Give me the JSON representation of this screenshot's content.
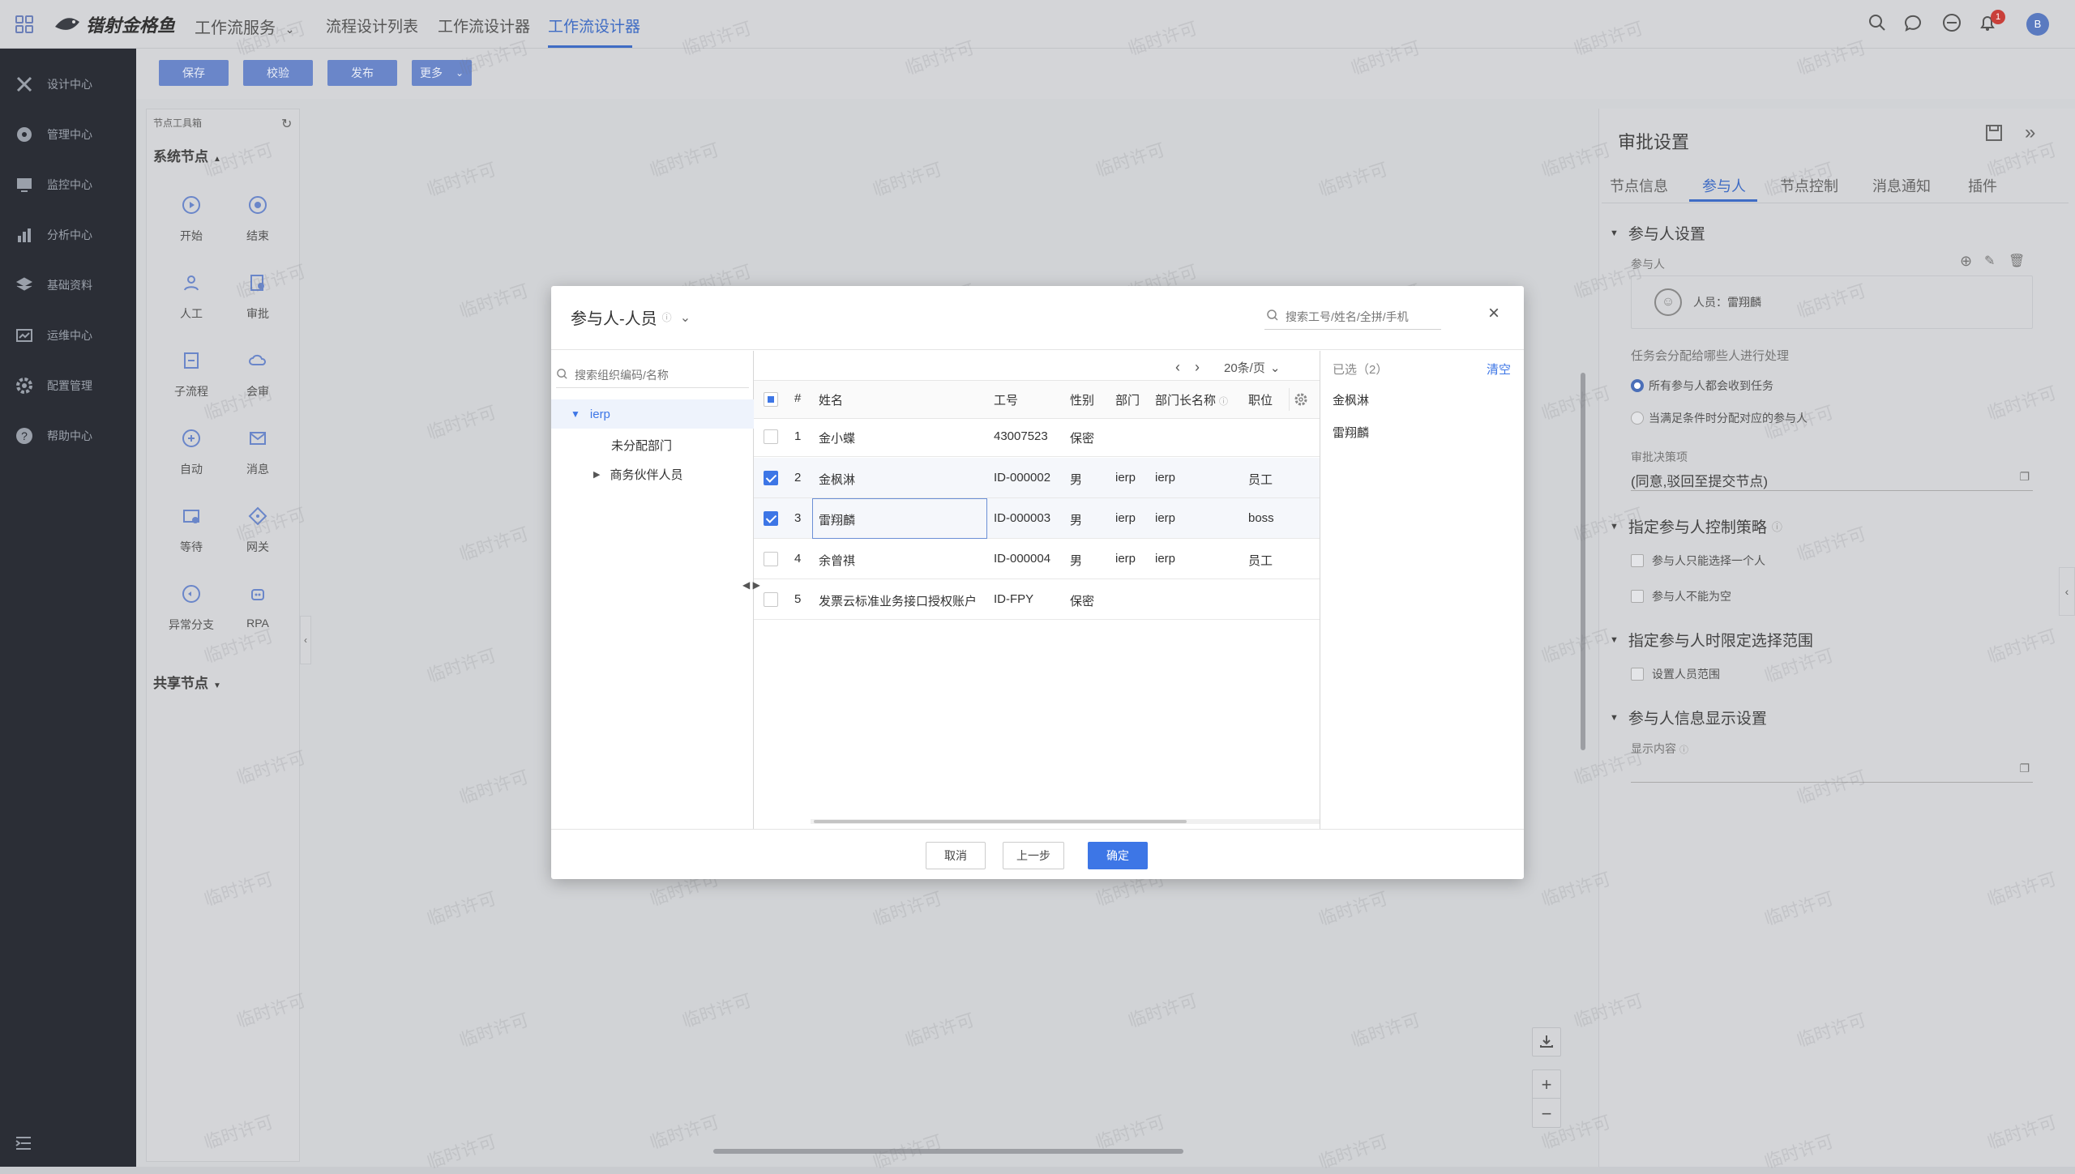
{
  "topbar": {
    "brand": "锴射金格鱼",
    "menu_service": "工作流服务",
    "nav": [
      "流程设计列表",
      "工作流设计器",
      "工作流设计器"
    ],
    "active_index": 2,
    "notice_count": "1",
    "avatar": "B"
  },
  "sidebar": {
    "items": [
      "设计中心",
      "管理中心",
      "监控中心",
      "分析中心",
      "基础资料",
      "运维中心",
      "配置管理",
      "帮助中心"
    ]
  },
  "toolbar": {
    "save": "保存",
    "check": "校验",
    "publish": "发布",
    "more": "更多"
  },
  "toolbox": {
    "title": "节点工具箱",
    "system_nodes": "系统节点",
    "shared_nodes": "共享节点",
    "nodes": [
      "开始",
      "结束",
      "人工",
      "审批",
      "子流程",
      "会审",
      "自动",
      "消息",
      "等待",
      "网关",
      "异常分支",
      "RPA"
    ]
  },
  "panel": {
    "title": "审批设置",
    "tabs": [
      "节点信息",
      "参与人",
      "节点控制",
      "消息通知",
      "插件"
    ],
    "active_tab": 1,
    "sec1": "参与人设置",
    "participant_label": "参与人",
    "participant_value": "人员：雷翔麟",
    "dispatch_label": "任务会分配给哪些人进行处理",
    "radio1": "所有参与人都会收到任务",
    "radio2": "当满足条件时分配对应的参与人",
    "decision_label": "审批决策项",
    "decision_value": "(同意,驳回至提交节点)",
    "sec2": "指定参与人控制策略",
    "opt1": "参与人只能选择一个人",
    "opt2": "参与人不能为空",
    "sec3": "指定参与人时限定选择范围",
    "opt3": "设置人员范围",
    "sec4": "参与人信息显示设置",
    "display_label": "显示内容"
  },
  "modal": {
    "title": "参与人-人员",
    "search_placeholder": "搜索工号/姓名/全拼/手机",
    "tree_placeholder": "搜索组织编码/名称",
    "tree": [
      "ierp",
      "未分配部门",
      "商务伙伴人员"
    ],
    "page_size": "20条/页",
    "columns": [
      "#",
      "姓名",
      "工号",
      "性别",
      "部门",
      "部门长名称",
      "职位"
    ],
    "rows": [
      {
        "no": "1",
        "name": "金小蝶",
        "id": "43007523",
        "sex": "保密",
        "dept": "",
        "head": "",
        "pos": "",
        "checked": false
      },
      {
        "no": "2",
        "name": "金枫淋",
        "id": "ID-000002",
        "sex": "男",
        "dept": "ierp",
        "head": "ierp",
        "pos": "员工",
        "checked": true
      },
      {
        "no": "3",
        "name": "雷翔麟",
        "id": "ID-000003",
        "sex": "男",
        "dept": "ierp",
        "head": "ierp",
        "pos": "boss",
        "checked": true
      },
      {
        "no": "4",
        "name": "余曾祺",
        "id": "ID-000004",
        "sex": "男",
        "dept": "ierp",
        "head": "ierp",
        "pos": "员工",
        "checked": false
      },
      {
        "no": "5",
        "name": "发票云标准业务接口授权账户",
        "id": "ID-FPY",
        "sex": "保密",
        "dept": "",
        "head": "",
        "pos": "",
        "checked": false
      }
    ],
    "selected_title": "已选（2）",
    "clear": "清空",
    "selected": [
      "金枫淋",
      "雷翔麟"
    ],
    "cancel": "取消",
    "prev": "上一步",
    "ok": "确定"
  },
  "watermark": "临时许可"
}
